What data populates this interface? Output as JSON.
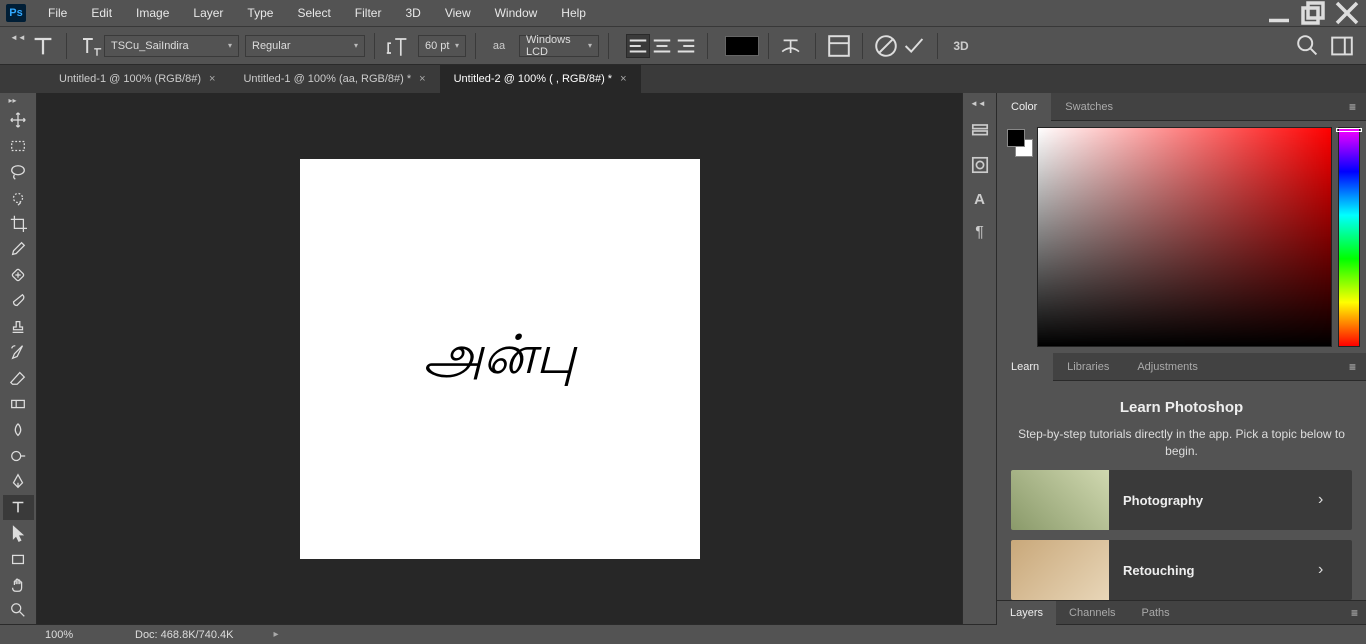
{
  "app_icon": "Ps",
  "menu": [
    "File",
    "Edit",
    "Image",
    "Layer",
    "Type",
    "Select",
    "Filter",
    "3D",
    "View",
    "Window",
    "Help"
  ],
  "options": {
    "font_family": "TSCu_SaiIndira",
    "font_style": "Regular",
    "font_size": "60 pt",
    "aa_label": "aa",
    "aa_mode": "Windows LCD",
    "threeD": "3D"
  },
  "tabs": [
    {
      "label": "Untitled-1 @ 100% (RGB/8#)",
      "active": false
    },
    {
      "label": "Untitled-1 @ 100% (aa, RGB/8#) *",
      "active": false
    },
    {
      "label": "Untitled-2 @ 100% ( , RGB/8#) *",
      "active": true
    }
  ],
  "canvas_text": "அன்பு",
  "right": {
    "color_tabs": [
      "Color",
      "Swatches"
    ],
    "learn_tabs": [
      "Learn",
      "Libraries",
      "Adjustments"
    ],
    "learn_title": "Learn Photoshop",
    "learn_desc": "Step-by-step tutorials directly in the app. Pick a topic below to begin.",
    "learn_items": [
      "Photography",
      "Retouching"
    ],
    "bottom_tabs": [
      "Layers",
      "Channels",
      "Paths"
    ]
  },
  "status": {
    "zoom": "100%",
    "doc": "Doc: 468.8K/740.4K"
  }
}
